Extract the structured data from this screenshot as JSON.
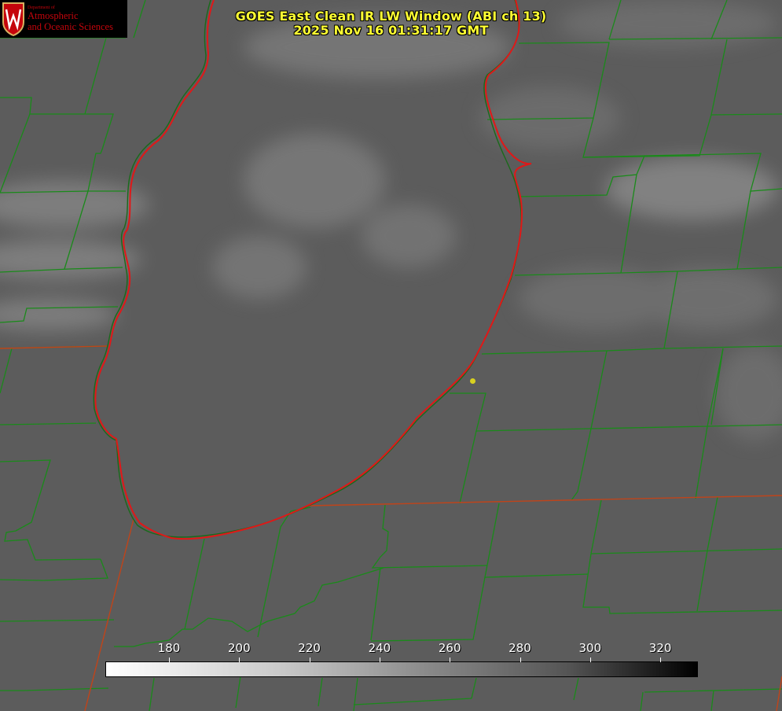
{
  "title": {
    "line1": "GOES East Clean IR LW Window (ABI ch 13)",
    "line2": "2025 Nov 16 01:31:17 GMT"
  },
  "logo": {
    "department": "Department of",
    "name_line1": "Atmospheric",
    "name_line2": "and Oceanic Sciences"
  },
  "colorbar": {
    "labels": [
      "180",
      "200",
      "220",
      "240",
      "260",
      "280",
      "300",
      "320"
    ],
    "gradient": "white (cold) to black (warm)"
  },
  "colors": {
    "title": "#ffff33",
    "county_lines": "#1a8a1a",
    "state_lines": "#c0441a",
    "lake_outline": "#e01818",
    "station_marker": "#d8d020",
    "logo_text": "#c5050c"
  }
}
